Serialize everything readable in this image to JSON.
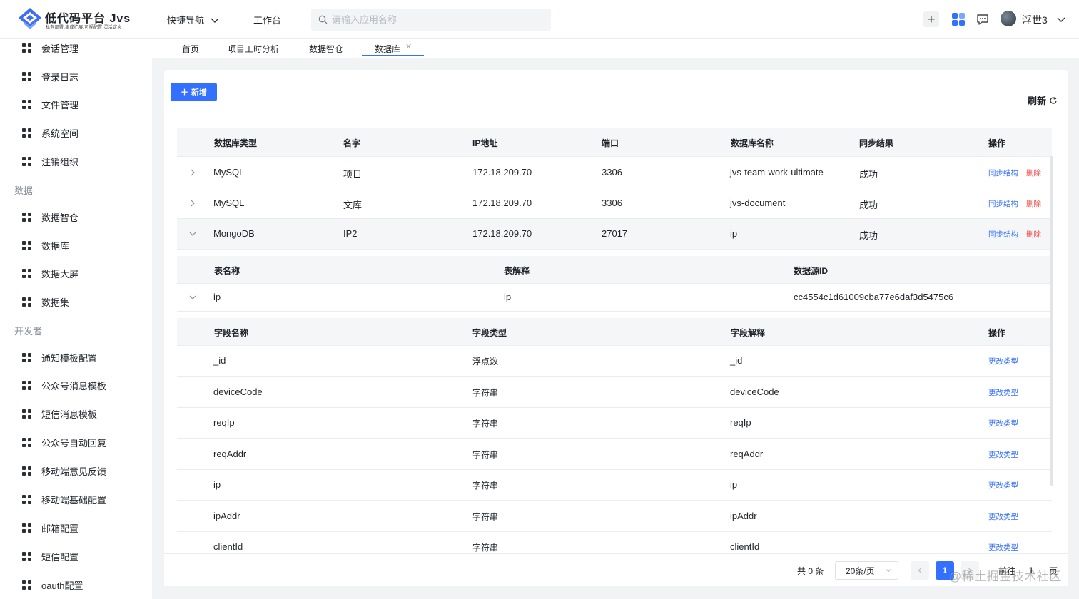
{
  "header": {
    "brand_title": "低代码平台 Jvs",
    "brand_subtitle": "私有部署.集成扩展.可视配置.灵活定义",
    "quick_nav": "快捷导航",
    "workbench": "工作台",
    "search_placeholder": "请输入应用名称",
    "user_name": "浮世3"
  },
  "sidebar": {
    "items_top": [
      "会话管理",
      "登录日志",
      "文件管理",
      "系统空间",
      "注销组织"
    ],
    "group_data": "数据",
    "items_data": [
      "数据智仓",
      "数据库",
      "数据大屏",
      "数据集"
    ],
    "group_dev": "开发者",
    "items_dev": [
      "通知模板配置",
      "公众号消息模板",
      "短信消息模板",
      "公众号自动回复",
      "移动端意见反馈",
      "移动端基础配置",
      "邮箱配置",
      "短信配置",
      "oauth配置"
    ]
  },
  "tabs": [
    "首页",
    "项目工时分析",
    "数据智仓",
    "数据库"
  ],
  "toolbar": {
    "add_label": "新增",
    "refresh_label": "刷新"
  },
  "table": {
    "columns": [
      "数据库类型",
      "名字",
      "IP地址",
      "端口",
      "数据库名称",
      "同步结果",
      "操作"
    ],
    "rows": [
      {
        "type": "MySQL",
        "name": "项目",
        "ip": "172.18.209.70",
        "port": "3306",
        "db": "jvs-team-work-ultimate",
        "result": "成功",
        "sync": "同步结构",
        "del": "删除"
      },
      {
        "type": "MySQL",
        "name": "文库",
        "ip": "172.18.209.70",
        "port": "3306",
        "db": "jvs-document",
        "result": "成功",
        "sync": "同步结构",
        "del": "删除"
      },
      {
        "type": "MongoDB",
        "name": "IP2",
        "ip": "172.18.209.70",
        "port": "27017",
        "db": "ip",
        "result": "成功",
        "sync": "同步结构",
        "del": "删除"
      }
    ]
  },
  "subtable": {
    "columns": [
      "表名称",
      "表解释",
      "数据源ID"
    ],
    "row": {
      "name": "ip",
      "desc": "ip",
      "source_id": "cc4554c1d61009cba77e6daf3d5475c6"
    }
  },
  "fields": {
    "columns": [
      "字段名称",
      "字段类型",
      "字段解释",
      "操作"
    ],
    "rows": [
      {
        "name": "_id",
        "type": "浮点数",
        "desc": "_id",
        "action": "更改类型"
      },
      {
        "name": "deviceCode",
        "type": "字符串",
        "desc": "deviceCode",
        "action": "更改类型"
      },
      {
        "name": "reqIp",
        "type": "字符串",
        "desc": "reqIp",
        "action": "更改类型"
      },
      {
        "name": "reqAddr",
        "type": "字符串",
        "desc": "reqAddr",
        "action": "更改类型"
      },
      {
        "name": "ip",
        "type": "字符串",
        "desc": "ip",
        "action": "更改类型"
      },
      {
        "name": "ipAddr",
        "type": "字符串",
        "desc": "ipAddr",
        "action": "更改类型"
      },
      {
        "name": "clientId",
        "type": "字符串",
        "desc": "clientId",
        "action": "更改类型"
      }
    ]
  },
  "pagination": {
    "total": "共 0 条",
    "page_size": "20条/页",
    "current_page": "1",
    "goto_label": "前往",
    "goto_value": "1",
    "goto_suffix": "页"
  },
  "watermark": "@稀土掘金技术社区",
  "colors": {
    "accent": "#3370ff",
    "danger": "#f54a45"
  }
}
